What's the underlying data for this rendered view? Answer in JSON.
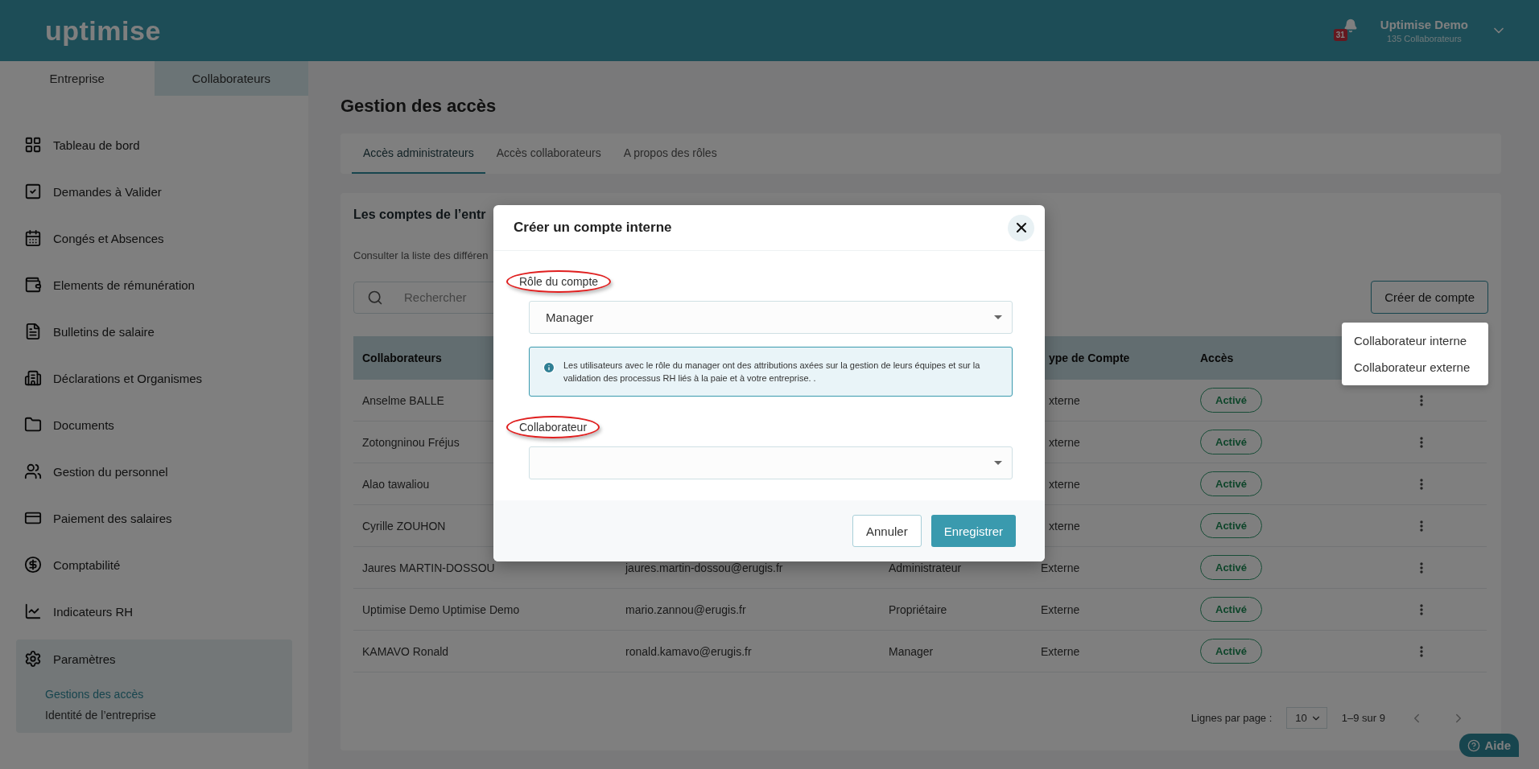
{
  "header": {
    "logo": "uptimise",
    "notifications": {
      "count": "31"
    },
    "user": {
      "name": "Uptimise Demo",
      "subtitle": "135 Collaborateurs"
    }
  },
  "sidebar": {
    "tabs": [
      {
        "label": "Entreprise",
        "selected": false
      },
      {
        "label": "Collaborateurs",
        "selected": true
      }
    ],
    "items": [
      {
        "label": "Tableau de bord",
        "expanded": false
      },
      {
        "label": "Demandes à Valider",
        "expanded": false
      },
      {
        "label": "Congés et Absences",
        "expanded": false
      },
      {
        "label": "Elements de rémunération",
        "expanded": false
      },
      {
        "label": "Bulletins de salaire",
        "expanded": false
      },
      {
        "label": "Déclarations et Organismes",
        "expanded": false
      },
      {
        "label": "Documents",
        "expanded": false
      },
      {
        "label": "Gestion du personnel",
        "expanded": false
      },
      {
        "label": "Paiement des salaires",
        "expanded": false
      },
      {
        "label": "Comptabilité",
        "expanded": false
      },
      {
        "label": "Indicateurs RH",
        "expanded": false
      },
      {
        "label": "Paramètres",
        "expanded": true,
        "children": [
          {
            "label": "Gestions des accès",
            "selected": true
          },
          {
            "label": "Identité de l’entreprise",
            "selected": false
          }
        ]
      }
    ]
  },
  "main": {
    "title": "Gestion des accès",
    "tabs": [
      {
        "label": "Accès administrateurs",
        "selected": true
      },
      {
        "label": "Accès collaborateurs",
        "selected": false
      },
      {
        "label": "A propos des rôles",
        "selected": false
      }
    ],
    "card": {
      "title": "Les comptes de l’entr",
      "subtitle": "Consulter la liste des différen",
      "search": {
        "placeholder": "Rechercher"
      },
      "create_button": "Créer de compte",
      "create_menu": [
        "Collaborateur interne",
        "Collaborateur externe"
      ],
      "table": {
        "columns": [
          {
            "kind": "name",
            "label": "Collaborateurs"
          },
          {
            "kind": "type",
            "label": "ype de Compte"
          },
          {
            "kind": "access",
            "label": "Accès"
          }
        ],
        "rows": [
          {
            "name": "Anselme BALLE",
            "type": "xterne",
            "access": "Activé"
          },
          {
            "name": "Zotongninou Fréjus",
            "type": "xterne",
            "access": "Activé"
          },
          {
            "name": "Alao tawaliou",
            "type": "xterne",
            "access": "Activé"
          },
          {
            "name": "Cyrille ZOUHON",
            "type": "xterne",
            "access": "Activé"
          },
          {
            "name": "Jaures MARTIN-DOSSOU",
            "email": "jaures.martin-dossou@erugis.fr",
            "role": "Administrateur",
            "type": "Externe",
            "access": "Activé"
          },
          {
            "name": "Uptimise Demo Uptimise Demo",
            "email": "mario.zannou@erugis.fr",
            "role": "Propriétaire",
            "type": "Externe",
            "access": "Activé"
          },
          {
            "name": "KAMAVO Ronald",
            "email": "ronald.kamavo@erugis.fr",
            "role": "Manager",
            "type": "Externe",
            "access": "Activé"
          }
        ]
      },
      "pagination": {
        "label": "Lignes par page :",
        "per_page": "10",
        "range": "1–9 sur 9"
      }
    }
  },
  "help_button": "Aide",
  "modal": {
    "title": "Créer un compte interne",
    "fields": [
      {
        "label": "Rôle du compte",
        "circled": true,
        "value": "Manager"
      },
      {
        "label": "Collaborateur",
        "circled": true
      }
    ],
    "info": "Les utilisateurs avec le rôle du manager ont des attributions axées sur la gestion de leurs équipes et sur la validation des processus RH liés à la paie et à votre entreprise. .",
    "buttons": [
      {
        "label": "Annuler",
        "kind": "secondary"
      },
      {
        "label": "Enregistrer",
        "kind": "primary"
      }
    ]
  }
}
